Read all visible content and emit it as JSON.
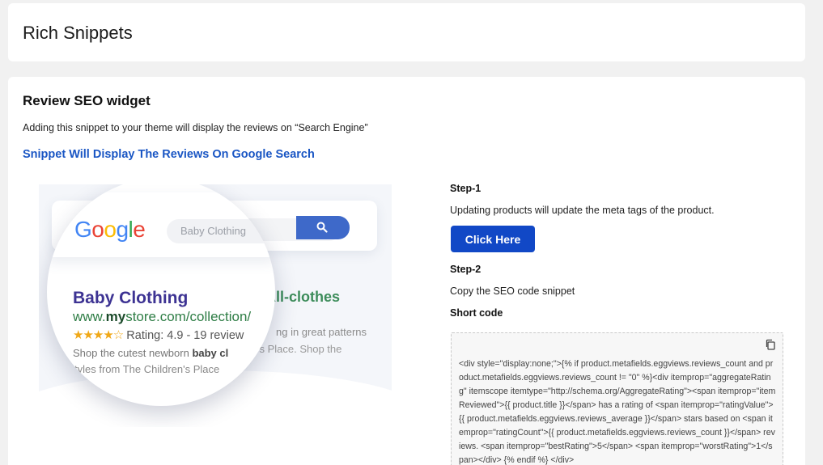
{
  "header": {
    "title": "Rich Snippets"
  },
  "widget": {
    "title": "Review SEO widget",
    "description": "Adding this snippet to your theme will display the reviews on “Search Engine”",
    "link_label": "Snippet Will Display The Reviews On Google Search"
  },
  "illustration": {
    "google_letters": [
      "G",
      "o",
      "o",
      "g",
      "l",
      "e"
    ],
    "search_placeholder": "Baby Clothing",
    "result_title": "Baby Clothing",
    "result_url_prefix": "www.",
    "result_url_bold": "my",
    "result_url_suffix": "store.com/collection/",
    "rating_stars": "★★★★☆",
    "rating_text": "Rating: 4.9 - 19 review",
    "snippet_line1_start": "Shop the cutest newborn ",
    "snippet_line1_bold": "baby cl",
    "snippet_line2": "tyles from The Children's Place",
    "bg_title_tail": "All-clothes",
    "bg_line1_tail": "ng in great patterns",
    "bg_line2_tail": "'s Place. Shop the",
    "colors": {
      "blue": "#4285f4",
      "red": "#ea4335",
      "yellow": "#fbbc05",
      "green": "#34a853"
    }
  },
  "steps": {
    "step1_label": "Step-1",
    "step1_text": "Updating products will update the meta tags of the product.",
    "button_label": "Click Here",
    "step2_label": "Step-2",
    "step2_text": "Copy the SEO code snippet",
    "short_code_label": "Short code",
    "code_snippet": "<div style=\"display:none;\">{% if product.metafields.eggviews.reviews_count and product.metafields.eggviews.reviews_count != \"0\" %}<div itemprop=\"aggregateRating\" itemscope itemtype=\"http://schema.org/AggregateRating\"><span itemprop=\"itemReviewed\">{{ product.title }}</span> has a rating of <span itemprop=\"ratingValue\">{{ product.metafields.eggviews.reviews_average }}</span> stars based on <span itemprop=\"ratingCount\">{{ product.metafields.eggviews.reviews_count }}</span> reviews. <span itemprop=\"bestRating\">5</span> <span itemprop=\"worstRating\">1</span></div> {% endif %} </div>"
  },
  "colors": {
    "accent": "#1148c6",
    "link": "#1a56c4"
  }
}
